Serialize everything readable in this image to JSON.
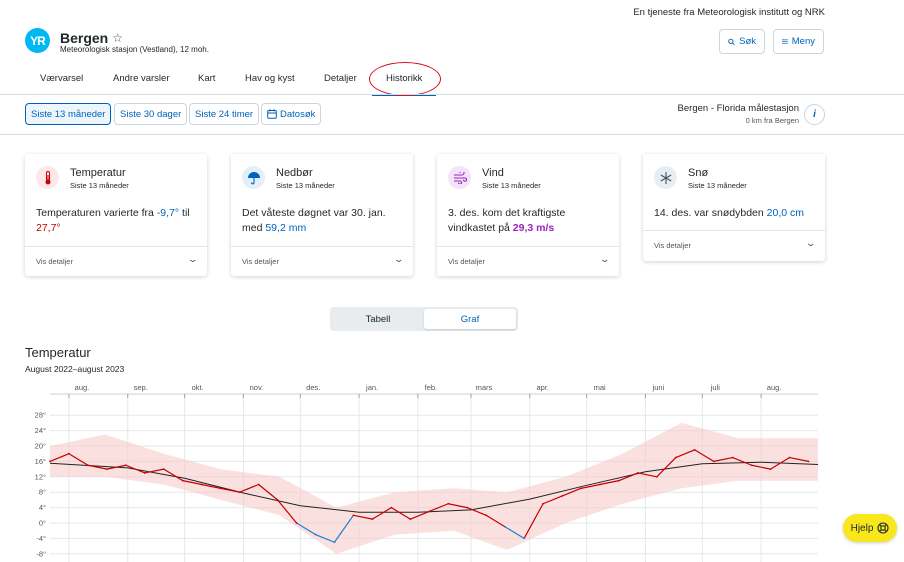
{
  "header": {
    "service_note": "En tjeneste fra Meteorologisk institutt og NRK",
    "logo_text": "YR",
    "location_name": "Bergen",
    "location_sub": "Meteorologisk stasjon (Vestland), 12 moh.",
    "search_label": "Søk",
    "menu_label": "Meny"
  },
  "tabs": [
    "Værvarsel",
    "Andre varsler",
    "Kart",
    "Hav og kyst",
    "Detaljer",
    "Historikk"
  ],
  "active_tab": "Historikk",
  "period_buttons": [
    "Siste 13 måneder",
    "Siste 30 dager",
    "Siste 24 timer",
    "Datosøk"
  ],
  "active_period": "Siste 13 måneder",
  "station": {
    "name": "Bergen - Florida målestasjon",
    "distance": "0 km fra Bergen",
    "info_icon_label": "i"
  },
  "cards": [
    {
      "title": "Temperatur",
      "subtitle": "Siste 13 måneder",
      "text_pre": "Temperaturen varierte fra ",
      "value1": "-9,7°",
      "text_mid": " til ",
      "value2": "27,7°",
      "text_post": "",
      "footer": "Vis detaljer"
    },
    {
      "title": "Nedbør",
      "subtitle": "Siste 13 måneder",
      "text_pre": "Det våteste døgnet var 30. jan. med ",
      "value1": "59,2 mm",
      "footer": "Vis detaljer"
    },
    {
      "title": "Vind",
      "subtitle": "Siste 13 måneder",
      "text_pre": "3. des. kom det kraftigste vindkastet på ",
      "value1": "29,3 m/s",
      "footer": "Vis detaljer"
    },
    {
      "title": "Snø",
      "subtitle": "Siste 13 måneder",
      "text_pre": "14. des. var snødybden ",
      "value1": "20,0 cm",
      "footer": "Vis detaljer"
    }
  ],
  "view_toggle": {
    "table": "Tabell",
    "graph": "Graf",
    "active": "Graf"
  },
  "chart_title": "Temperatur",
  "chart_subtitle": "August 2022–august 2023",
  "help_label": "Hjelp",
  "colors": {
    "accent": "#0062ba",
    "logo": "#00b8f1",
    "warm_line": "#c60000",
    "cold_line": "#1a7fd4",
    "range_band": "#f7c6c6",
    "normal_line": "#222222",
    "help_button": "#f8e71c",
    "highlight_ring": "#d4111d"
  },
  "icons": {
    "search": "search-icon",
    "menu": "hamburger-icon",
    "star": "star-icon",
    "calendar": "calendar-icon",
    "temperature": "thermometer-icon",
    "precipitation": "umbrella-icon",
    "wind": "wind-icon",
    "snow": "snowflake-icon",
    "help": "lifebuoy-icon"
  },
  "chart_data": {
    "type": "line",
    "title": "Temperatur",
    "subtitle": "August 2022–august 2023",
    "x_type": "time",
    "x_start": "2022-07-22",
    "x_end": "2023-08-31",
    "x_ticks": [
      "aug.",
      "sep.",
      "okt.",
      "nov.",
      "des.",
      "jan.",
      "feb.",
      "mars",
      "apr.",
      "mai",
      "juni",
      "juli",
      "aug."
    ],
    "y_ticks": [
      "28°",
      "24°",
      "20°",
      "16°",
      "12°",
      "8°",
      "4°",
      "0°",
      "-4°",
      "-8°"
    ],
    "ylim": [
      -8,
      30
    ],
    "grid": true,
    "series": [
      {
        "style": "daily mean temperature, red above 0°, blue below 0°",
        "x": [
          "2022-07-22",
          "2022-08-01",
          "2022-08-11",
          "2022-08-21",
          "2022-08-31",
          "2022-09-10",
          "2022-09-20",
          "2022-09-30",
          "2022-10-10",
          "2022-10-20",
          "2022-10-30",
          "2022-11-09",
          "2022-11-19",
          "2022-11-29",
          "2022-12-09",
          "2022-12-19",
          "2022-12-29",
          "2023-01-08",
          "2023-01-18",
          "2023-01-28",
          "2023-02-07",
          "2023-02-17",
          "2023-02-27",
          "2023-03-09",
          "2023-03-19",
          "2023-03-29",
          "2023-04-08",
          "2023-04-18",
          "2023-04-28",
          "2023-05-08",
          "2023-05-18",
          "2023-05-28",
          "2023-06-07",
          "2023-06-17",
          "2023-06-27",
          "2023-07-07",
          "2023-07-17",
          "2023-07-27",
          "2023-08-06",
          "2023-08-16",
          "2023-08-26"
        ],
        "values": [
          16,
          18,
          15,
          14,
          15,
          13,
          14,
          11,
          10,
          9,
          8,
          10,
          6,
          0,
          -3,
          -5,
          2,
          1,
          4,
          1,
          3,
          5,
          4,
          2,
          -1,
          -4,
          5,
          7,
          9,
          10,
          11,
          13,
          12,
          17,
          19,
          16,
          17,
          15,
          14,
          17,
          16
        ]
      },
      {
        "style": "normal temperature",
        "x": [
          "2022-07-22",
          "2022-09-01",
          "2022-10-01",
          "2022-11-01",
          "2022-12-01",
          "2023-01-01",
          "2023-02-01",
          "2023-03-01",
          "2023-04-01",
          "2023-05-01",
          "2023-06-01",
          "2023-07-01",
          "2023-08-01",
          "2023-08-31"
        ],
        "values": [
          15.5,
          14.3,
          11.6,
          7.8,
          4.5,
          2.8,
          2.8,
          3.4,
          6.2,
          9.8,
          13.3,
          15.4,
          15.8,
          15.2
        ]
      },
      {
        "style": "daily min–max range band",
        "x": [
          "2022-07-22",
          "2022-08-20",
          "2022-09-20",
          "2022-10-20",
          "2022-11-20",
          "2022-12-20",
          "2023-01-20",
          "2023-02-20",
          "2023-03-20",
          "2023-04-20",
          "2023-05-20",
          "2023-06-20",
          "2023-07-20",
          "2023-08-31"
        ],
        "high": [
          20,
          23,
          18,
          14,
          12,
          4,
          8,
          9,
          8,
          12,
          18,
          26,
          22,
          22
        ],
        "low": [
          12,
          12,
          10,
          6,
          2,
          -8,
          -3,
          -2,
          -7,
          0,
          5,
          9,
          11,
          11
        ]
      }
    ]
  }
}
